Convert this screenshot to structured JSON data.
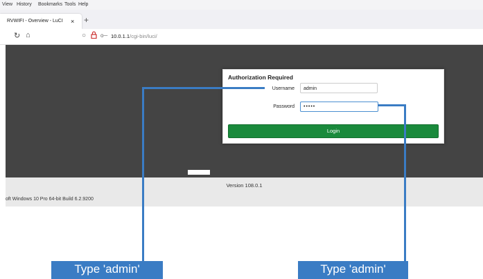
{
  "browser": {
    "menu": [
      "View",
      "History",
      "Bookmarks",
      "Tools",
      "Help"
    ],
    "tab_title": "RVWIFI - Overview - LuCI",
    "tab_close": "×",
    "new_tab": "+",
    "url_host": "10.0.1.1",
    "url_path": "/cgi-bin/luci/"
  },
  "login": {
    "title": "Authorization Required",
    "username_label": "Username",
    "username_value": "admin",
    "password_label": "Password",
    "password_value": "•••••",
    "login_label": "Login"
  },
  "footer": {
    "version": "Version 108.0.1",
    "os_build": "oft Windows 10 Pro 64-bit Build 6.2.9200"
  },
  "annotations": {
    "username_callout": "Type 'admin'",
    "password_callout": "Type 'admin'"
  },
  "colors": {
    "accent": "#3a7cc4",
    "login_button": "#1a8a3c",
    "page_dark": "#444444"
  }
}
